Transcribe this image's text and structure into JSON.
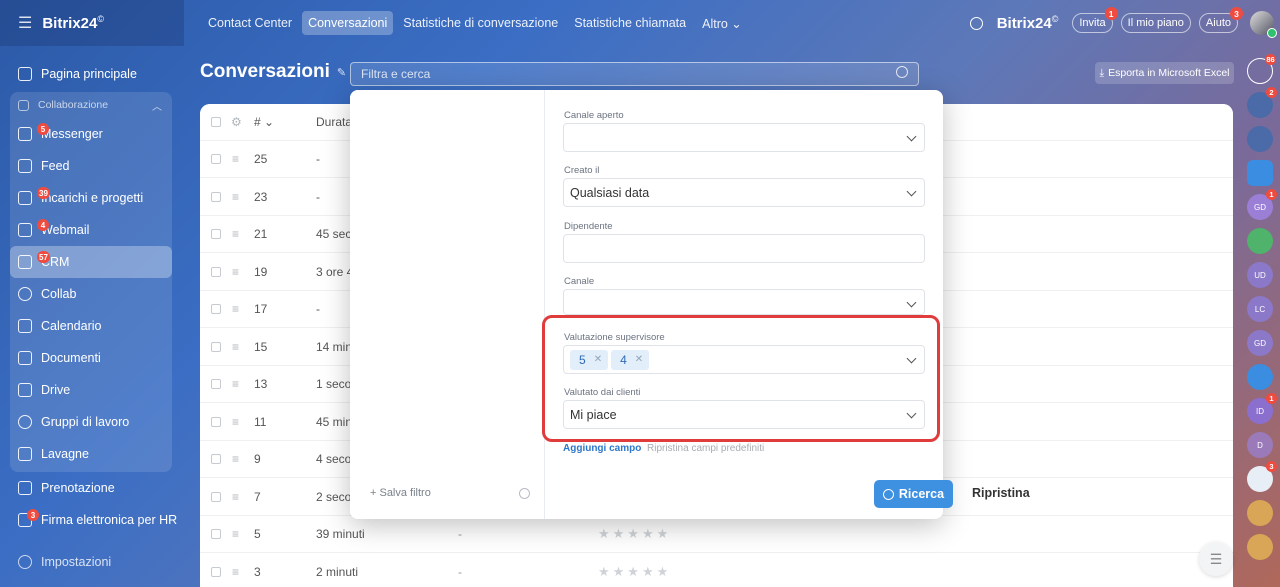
{
  "topbar": {
    "logo": "Bitrix24",
    "logo_mark": "©",
    "tabs": [
      {
        "label": "Contact Center",
        "active": false
      },
      {
        "label": "Conversazioni",
        "active": true
      },
      {
        "label": "Statistiche di conversazione",
        "active": false
      },
      {
        "label": "Statistiche chiamata",
        "active": false
      },
      {
        "label": "Altro ⌄",
        "active": false
      }
    ],
    "brand": "Bitrix24",
    "invite": "Invita",
    "invite_count": "1",
    "plan": "Il mio piano",
    "help": "Aiuto",
    "help_count": "3"
  },
  "sidebar": {
    "home": "Pagina principale",
    "group_label": "Collaborazione",
    "items": [
      {
        "label": "Messenger",
        "badge": "5",
        "icon": "chat-icon"
      },
      {
        "label": "Feed",
        "badge": "",
        "icon": "feed-icon"
      },
      {
        "label": "Incarichi e progetti",
        "badge": "39",
        "icon": "tasks-icon"
      },
      {
        "label": "Webmail",
        "badge": "4",
        "icon": "mail-icon"
      },
      {
        "label": "CRM",
        "badge": "57",
        "icon": "crm-icon"
      },
      {
        "label": "Collab",
        "badge": "",
        "icon": "collab-icon"
      },
      {
        "label": "Calendario",
        "badge": "",
        "icon": "calendar-icon"
      },
      {
        "label": "Documenti",
        "badge": "",
        "icon": "documents-icon"
      },
      {
        "label": "Drive",
        "badge": "",
        "icon": "drive-icon"
      },
      {
        "label": "Gruppi di lavoro",
        "badge": "",
        "icon": "groups-icon"
      },
      {
        "label": "Lavagne",
        "badge": "",
        "icon": "boards-icon"
      }
    ],
    "below": [
      {
        "label": "Prenotazione",
        "badge": "",
        "icon": "booking-icon"
      },
      {
        "label": "Firma elettronica per HR",
        "badge": "3",
        "icon": "signature-icon"
      }
    ],
    "settings": "Impostazioni"
  },
  "page": {
    "title": "Conversazioni",
    "search_placeholder": "Filtra e cerca",
    "export": "Esporta in Microsoft Excel"
  },
  "grid": {
    "header": {
      "num": "#",
      "duration": "Durata"
    },
    "rows": [
      {
        "id": "25",
        "duration": "-"
      },
      {
        "id": "23",
        "duration": "-"
      },
      {
        "id": "21",
        "duration": "45 seco"
      },
      {
        "id": "19",
        "duration": "3 ore 4"
      },
      {
        "id": "17",
        "duration": "-"
      },
      {
        "id": "15",
        "duration": "14 minu"
      },
      {
        "id": "13",
        "duration": "1 secon"
      },
      {
        "id": "11",
        "duration": "45 min"
      },
      {
        "id": "9",
        "duration": "4 secon"
      },
      {
        "id": "7",
        "duration": "2 secon"
      },
      {
        "id": "5",
        "duration": "39 minuti",
        "dash": "-",
        "stars": "★★★★★"
      },
      {
        "id": "3",
        "duration": "2 minuti",
        "dash": "-",
        "stars": "★★★★★"
      }
    ]
  },
  "filter": {
    "save_filter": "+ Salva filtro",
    "fields": {
      "open_channel": {
        "label": "Canale aperto",
        "value": ""
      },
      "created": {
        "label": "Creato il",
        "value": "Qualsiasi data"
      },
      "employee": {
        "label": "Dipendente",
        "value": ""
      },
      "channel": {
        "label": "Canale",
        "value": ""
      },
      "supervisor_rating": {
        "label": "Valutazione supervisore",
        "tags": [
          "5",
          "4"
        ]
      },
      "client_rating": {
        "label": "Valutato dai clienti",
        "value": "Mi piace"
      }
    },
    "add_field": "Aggiungi campo",
    "restore_fields": "Ripristina campi predefiniti",
    "search_button": "Ricerca",
    "reset_button": "Ripristina"
  },
  "rightbar": [
    {
      "label": "",
      "count": "86",
      "color": "#3b5f9e"
    },
    {
      "label": "",
      "count": "2",
      "color": "#4a6aa8"
    },
    {
      "label": "",
      "count": "",
      "color": "#4a6aa8"
    },
    {
      "label": "",
      "count": "",
      "color": "#3a8de0"
    },
    {
      "label": "GD",
      "count": "1",
      "color": "#9b7fd6"
    },
    {
      "label": "",
      "count": "",
      "color": "#4fb36b"
    },
    {
      "label": "UD",
      "count": "",
      "color": "#8b78c8"
    },
    {
      "label": "LC",
      "count": "",
      "color": "#8b78c8"
    },
    {
      "label": "GD",
      "count": "",
      "color": "#8b78c8"
    },
    {
      "label": "",
      "count": "",
      "color": "#3a8de0"
    },
    {
      "label": "ID",
      "count": "1",
      "color": "#8a6fcf"
    },
    {
      "label": "D",
      "count": "",
      "color": "#9a7ab8"
    },
    {
      "label": "",
      "count": "3",
      "color": "#e8eef5"
    },
    {
      "label": "",
      "count": "",
      "color": "#d8a656"
    },
    {
      "label": "",
      "count": "",
      "color": "#d8a656"
    }
  ]
}
